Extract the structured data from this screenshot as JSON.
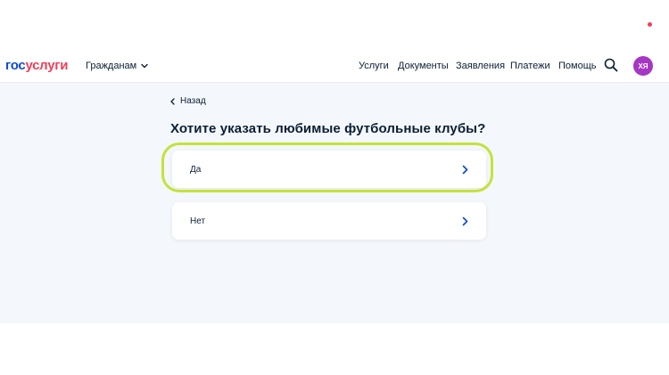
{
  "header": {
    "logo_part1": "гос",
    "logo_part2": "услуги",
    "citizens_label": "Гражданам",
    "nav": [
      "Услуги",
      "Документы",
      "Заявления",
      "Платежи",
      "Помощь"
    ],
    "avatar_initials": "ХЯ"
  },
  "page": {
    "back_label": "Назад",
    "question": "Хотите указать любимые футбольные клубы?",
    "options": [
      {
        "label": "Да"
      },
      {
        "label": "Нет"
      }
    ]
  },
  "colors": {
    "brand_blue": "#0d4cd3",
    "brand_red": "#ee3f58",
    "avatar": "#a537c4",
    "highlight": "#c5e23a",
    "background": "#f4f7fb"
  }
}
